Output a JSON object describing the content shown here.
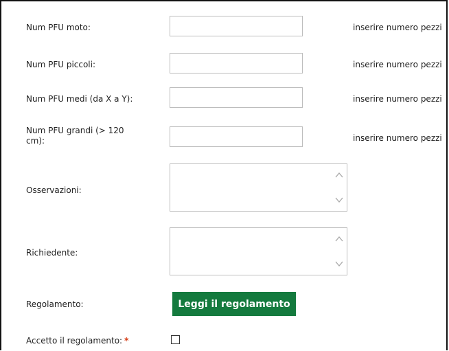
{
  "fields": [
    {
      "label": "Num PFU moto:",
      "value": "",
      "hint": "inserire numero pezzi"
    },
    {
      "label": "Num PFU piccoli:",
      "value": "",
      "hint": "inserire numero pezzi"
    },
    {
      "label": "Num PFU medi (da X a Y):",
      "value": "",
      "hint": "inserire numero pezzi"
    },
    {
      "label": "Num PFU grandi (> 120 cm):",
      "value": "",
      "hint": "inserire numero pezzi"
    }
  ],
  "observations": {
    "label": "Osservazioni:",
    "value": ""
  },
  "requester": {
    "label": "Richiedente:",
    "value": ""
  },
  "regulation": {
    "label": "Regolamento:",
    "button_label": "Leggi il regolamento"
  },
  "accept": {
    "label": "Accetto il regolamento:",
    "required_mark": "*",
    "checked": false
  },
  "colors": {
    "button_bg": "#147a3e",
    "required": "#d63b14"
  }
}
